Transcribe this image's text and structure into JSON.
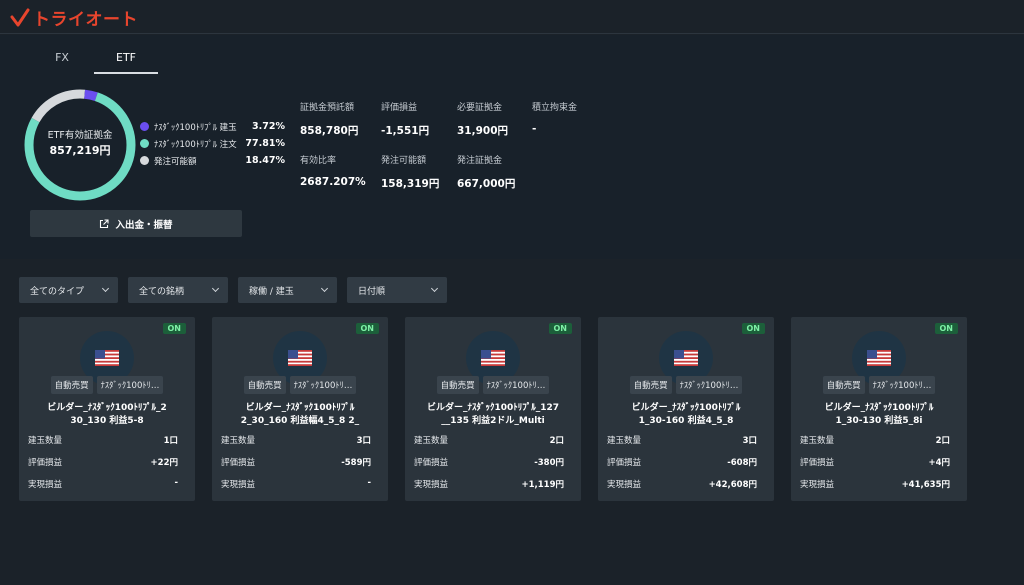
{
  "app": {
    "logo_text": "トライオート",
    "brand_color": "#e8452d"
  },
  "tabs": [
    {
      "label": "FX",
      "active": false
    },
    {
      "label": "ETF",
      "active": true
    }
  ],
  "summary": {
    "donut_label": "ETF有効証拠金",
    "donut_value": "857,219円",
    "legend": [
      {
        "name": "ﾅｽﾀﾞｯｸ100ﾄﾘﾌﾟﾙ 建玉",
        "pct": "3.72%",
        "color": "#6b4ef0",
        "fraction": 0.0372
      },
      {
        "name": "ﾅｽﾀﾞｯｸ100ﾄﾘﾌﾟﾙ 注文",
        "pct": "77.81%",
        "color": "#6fdcc4",
        "fraction": 0.7781
      },
      {
        "name": "発注可能額",
        "pct": "18.47%",
        "color": "#d6d9dc",
        "fraction": 0.1847
      }
    ],
    "stats": [
      {
        "label": "証拠金預託額",
        "value": "858,780円"
      },
      {
        "label": "評価損益",
        "value": "-1,551円"
      },
      {
        "label": "必要証拠金",
        "value": "31,900円"
      },
      {
        "label": "積立拘束金",
        "value": "-"
      },
      {
        "label": "有効比率",
        "value": "2687.207%"
      },
      {
        "label": "発注可能額",
        "value": "158,319円"
      },
      {
        "label": "発注証拠金",
        "value": "667,000円"
      }
    ],
    "transfer_button": "入出金・振替"
  },
  "filters": [
    {
      "label": "全てのタイプ"
    },
    {
      "label": "全ての銘柄"
    },
    {
      "label": "稼働 / 建玉"
    },
    {
      "label": "日付順"
    }
  ],
  "cards": [
    {
      "status": "ON",
      "tag1": "自動売買",
      "tag2": "ﾅｽﾀﾞｯｸ100ﾄﾘ…",
      "title_line1": "ビルダー_ﾅｽﾀﾞｯｸ100ﾄﾘﾌﾟﾙ_2",
      "title_line2": "30_130 利益5-8",
      "rows": [
        {
          "k": "建玉数量",
          "v": "1口"
        },
        {
          "k": "評価損益",
          "v": "+22円"
        },
        {
          "k": "実現損益",
          "v": "-"
        }
      ]
    },
    {
      "status": "ON",
      "tag1": "自動売買",
      "tag2": "ﾅｽﾀﾞｯｸ100ﾄﾘ…",
      "title_line1": "ビルダー_ﾅｽﾀﾞｯｸ100ﾄﾘﾌﾟﾙ",
      "title_line2": "2_30_160 利益幅4_5_8 2_",
      "rows": [
        {
          "k": "建玉数量",
          "v": "3口"
        },
        {
          "k": "評価損益",
          "v": "-589円"
        },
        {
          "k": "実現損益",
          "v": "-"
        }
      ]
    },
    {
      "status": "ON",
      "tag1": "自動売買",
      "tag2": "ﾅｽﾀﾞｯｸ100ﾄﾘ…",
      "title_line1": "ビルダー_ﾅｽﾀﾞｯｸ100ﾄﾘﾌﾟﾙ_127",
      "title_line2": "__135 利益2ドル_Multi",
      "rows": [
        {
          "k": "建玉数量",
          "v": "2口"
        },
        {
          "k": "評価損益",
          "v": "-380円"
        },
        {
          "k": "実現損益",
          "v": "+1,119円"
        }
      ]
    },
    {
      "status": "ON",
      "tag1": "自動売買",
      "tag2": "ﾅｽﾀﾞｯｸ100ﾄﾘ…",
      "title_line1": "ビルダー_ﾅｽﾀﾞｯｸ100ﾄﾘﾌﾟﾙ",
      "title_line2": "1_30-160 利益4_5_8",
      "rows": [
        {
          "k": "建玉数量",
          "v": "3口"
        },
        {
          "k": "評価損益",
          "v": "-608円"
        },
        {
          "k": "実現損益",
          "v": "+42,608円"
        }
      ]
    },
    {
      "status": "ON",
      "tag1": "自動売買",
      "tag2": "ﾅｽﾀﾞｯｸ100ﾄﾘ…",
      "title_line1": "ビルダー_ﾅｽﾀﾞｯｸ100ﾄﾘﾌﾟﾙ",
      "title_line2": "1_30-130 利益5_8i",
      "rows": [
        {
          "k": "建玉数量",
          "v": "2口"
        },
        {
          "k": "評価損益",
          "v": "+4円"
        },
        {
          "k": "実現損益",
          "v": "+41,635円"
        }
      ]
    }
  ]
}
